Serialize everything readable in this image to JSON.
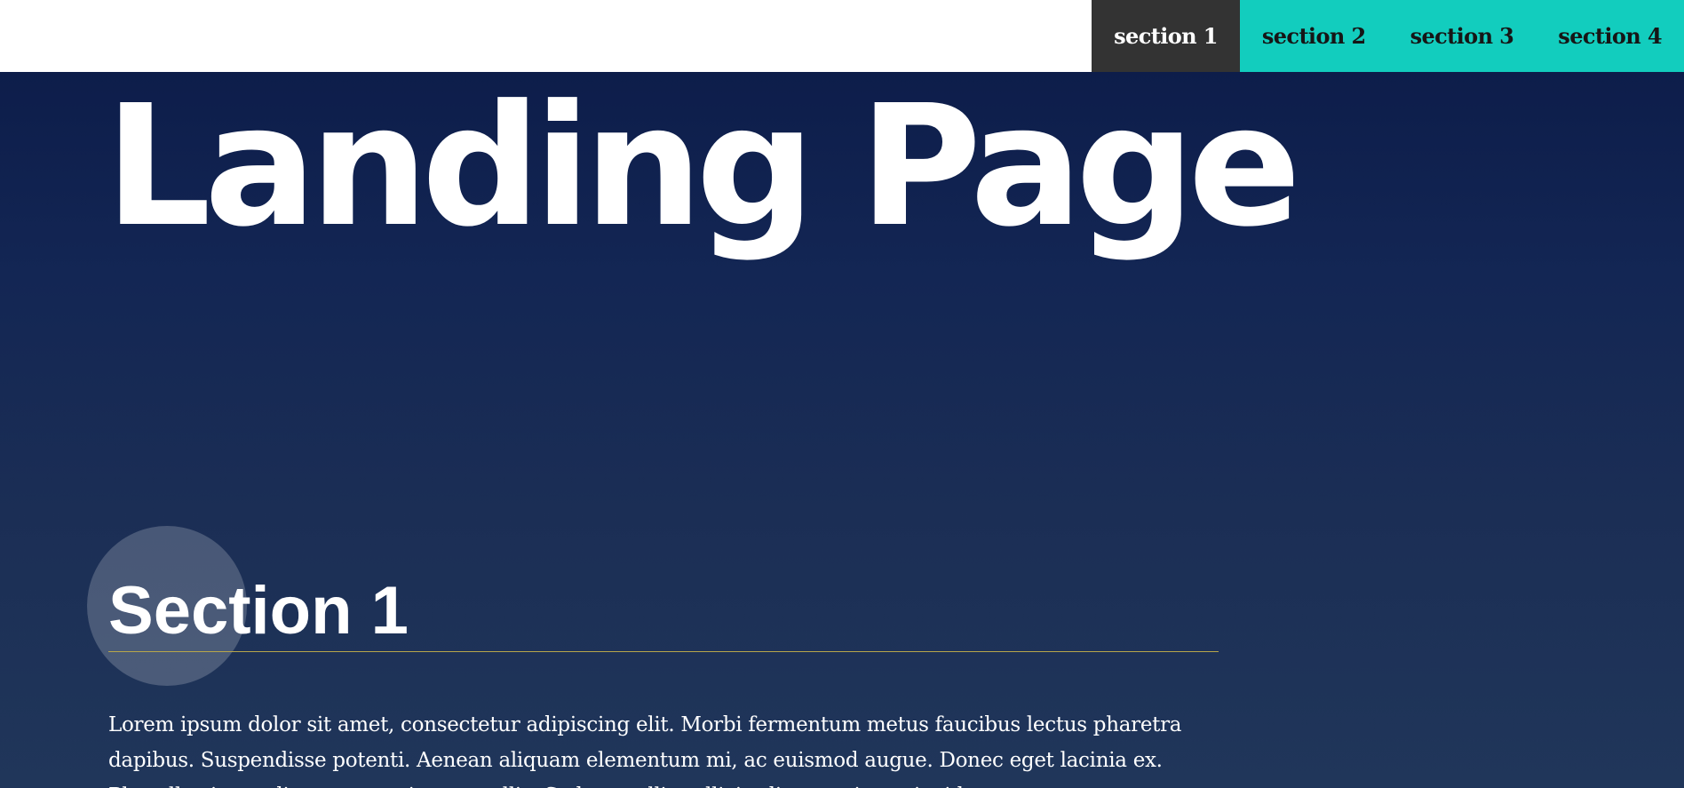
{
  "nav": {
    "items": [
      {
        "label": "section 1",
        "active": true
      },
      {
        "label": "section 2",
        "active": false
      },
      {
        "label": "section 3",
        "active": false
      },
      {
        "label": "section 4",
        "active": false
      }
    ]
  },
  "hero": {
    "title": "Landing Page"
  },
  "section1": {
    "title": "Section 1",
    "text": "Lorem ipsum dolor sit amet, consectetur adipiscing elit. Morbi fermentum metus faucibus lectus pharetra dapibus. Suspendisse potenti. Aenean aliquam elementum mi, ac euismod augue. Donec eget lacinia ex. Phasellus imperdiet porta orci eget mollis. Sed convallis sollicitudin mauris ac tincidunt."
  },
  "colors": {
    "nav_background": "#12cdbe",
    "nav_active": "#333333",
    "page_gradient_top": "#0b1a47",
    "page_gradient_bottom": "#20365a",
    "section_rule": "#b8a64a"
  }
}
